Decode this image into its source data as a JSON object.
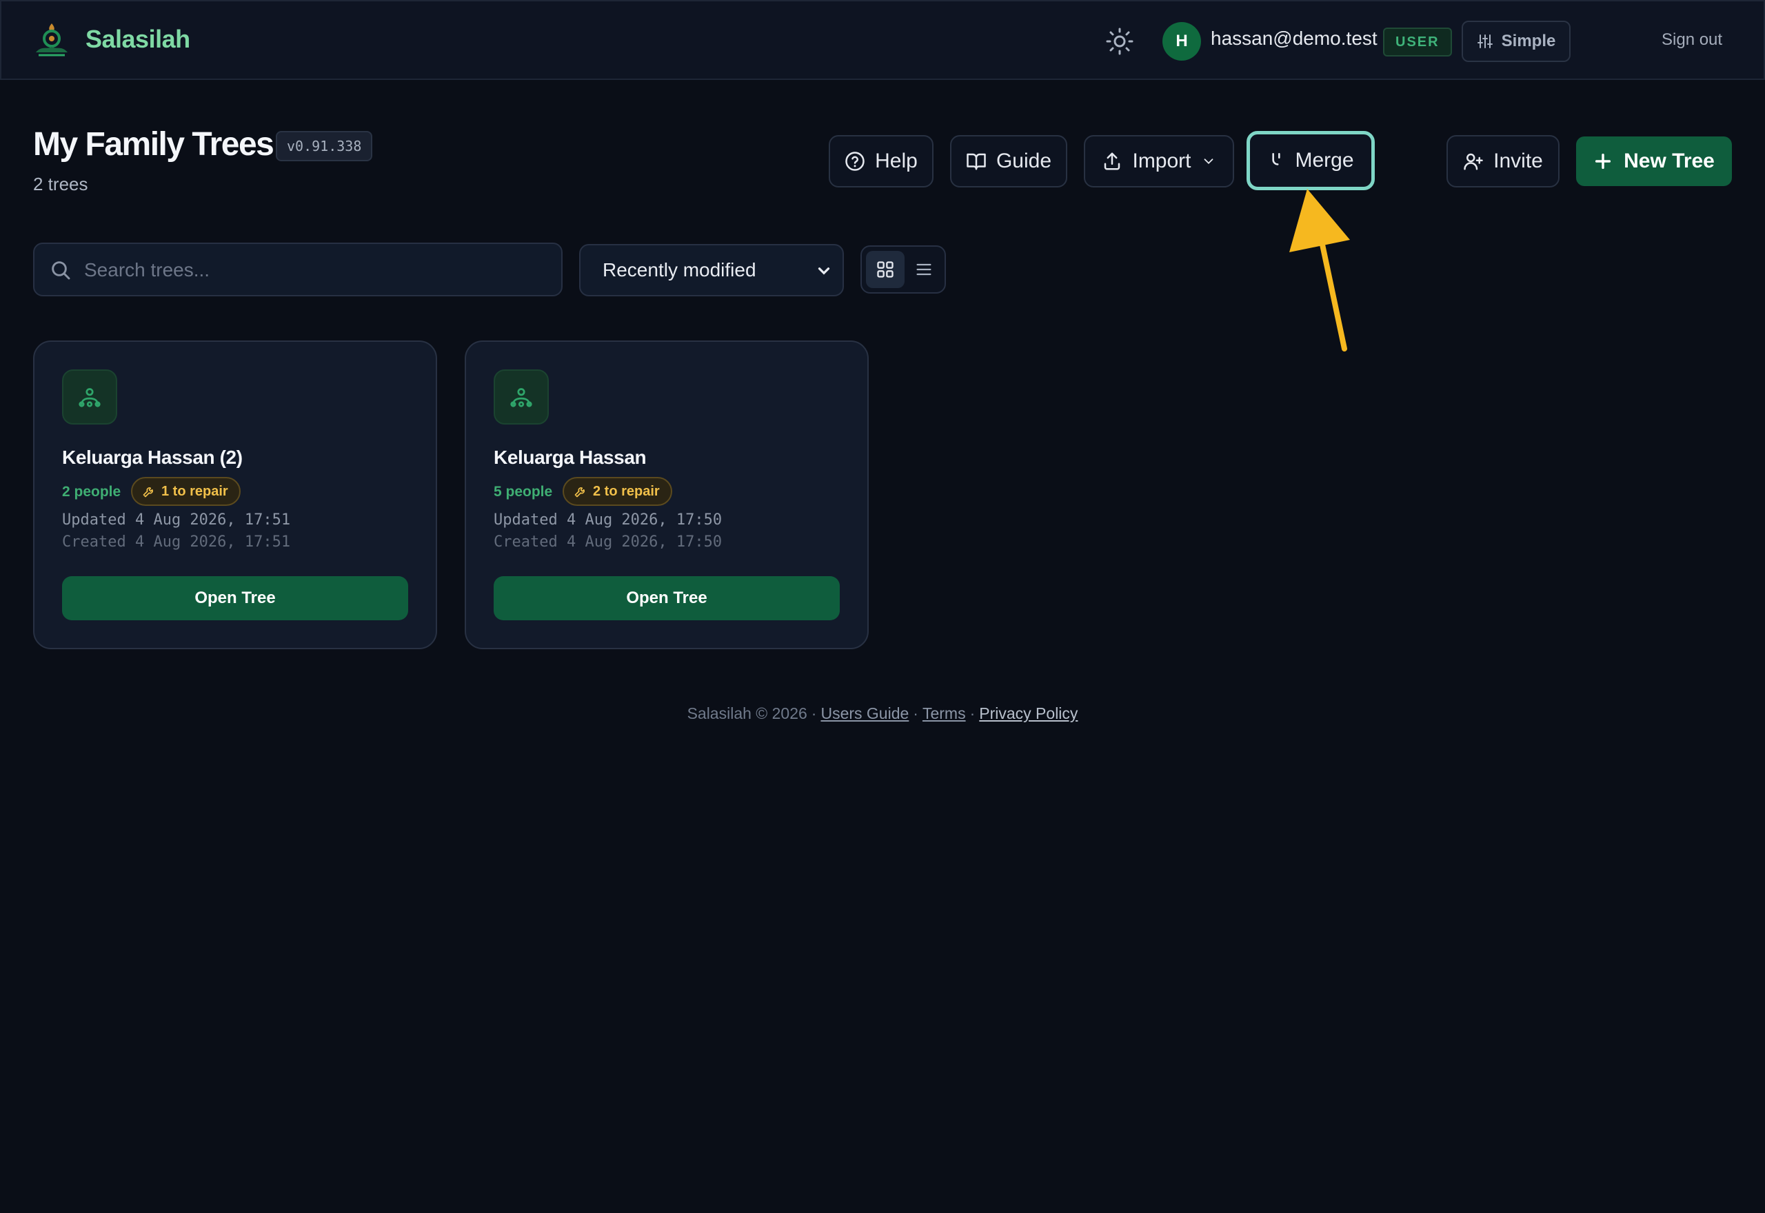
{
  "app": {
    "name": "Salasilah"
  },
  "topbar": {
    "theme_icon": "sun-icon",
    "user": {
      "initial": "H",
      "email": "hassan@demo.test",
      "role": "USER"
    },
    "mode_label": "Simple",
    "signout_label": "Sign out"
  },
  "header": {
    "title": "My Family Trees",
    "version": "v0.91.338",
    "tree_count": "2 trees",
    "buttons": {
      "help": "Help",
      "guide": "Guide",
      "import": "Import",
      "merge": "Merge",
      "invite": "Invite",
      "new_tree": "New Tree"
    }
  },
  "toolbar": {
    "search_placeholder": "Search trees...",
    "sort_value": "Recently modified",
    "view_mode": "grid"
  },
  "trees": [
    {
      "name": "Keluarga Hassan (2)",
      "people": "2 people",
      "repair": "1 to repair",
      "updated": "Updated 4 Aug 2026, 17:51",
      "created": "Created 4 Aug 2026, 17:51",
      "open_label": "Open Tree"
    },
    {
      "name": "Keluarga Hassan",
      "people": "5 people",
      "repair": "2 to repair",
      "updated": "Updated 4 Aug 2026, 17:50",
      "created": "Created 4 Aug 2026, 17:50",
      "open_label": "Open Tree"
    }
  ],
  "footer": {
    "copyright": "Salasilah © 2026",
    "links": [
      "Users Guide",
      "Terms",
      "Privacy Policy"
    ]
  },
  "colors": {
    "background": "#0a0e17",
    "brand": "#7fd9a4",
    "primary_button": "#0f5d3d",
    "highlight_ring": "#7fd6c6",
    "annotation_arrow": "#f6b81f",
    "repair_badge": "#f1c04a"
  }
}
